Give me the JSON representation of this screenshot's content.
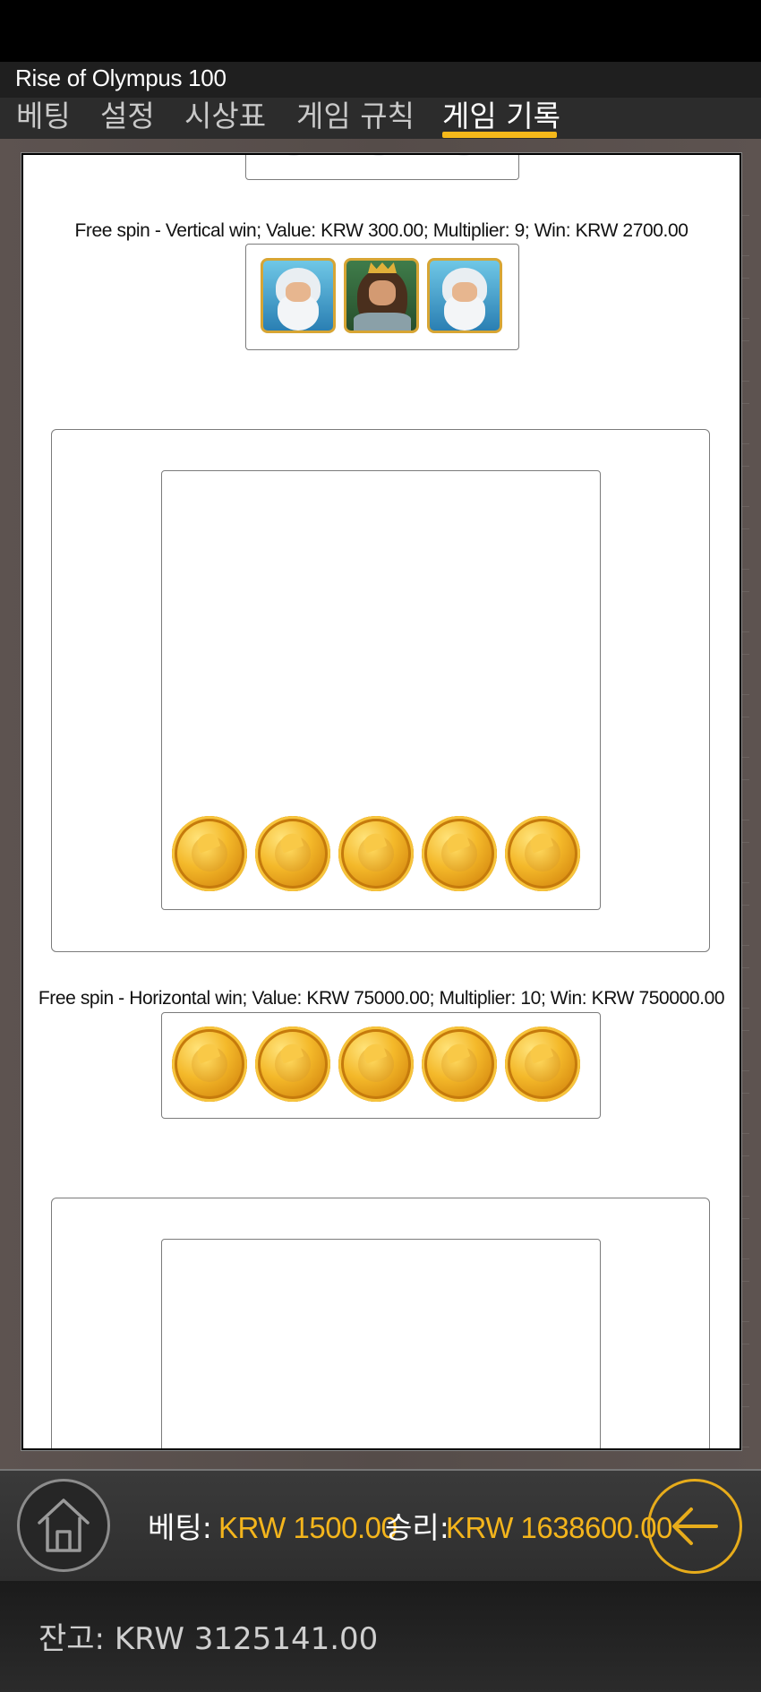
{
  "app": {
    "title": "Rise of Olympus 100"
  },
  "tabs": [
    {
      "label": "베팅",
      "active": false
    },
    {
      "label": "설정",
      "active": false
    },
    {
      "label": "시상표",
      "active": false
    },
    {
      "label": "게임 규칙",
      "active": false
    },
    {
      "label": "게임 기록",
      "active": true
    }
  ],
  "history": {
    "win1_caption": "Free spin - Vertical win; Value: KRW 300.00; Multiplier: 9; Win: KRW 2700.00",
    "win1_symbols": [
      "zeus-symbol",
      "hero-symbol",
      "zeus-symbol"
    ],
    "win2_caption": "Free spin - Horizontal win; Value: KRW 75000.00; Multiplier: 10; Win: KRW 750000.00",
    "win2_symbols": [
      "gold-coin-symbol",
      "gold-coin-symbol",
      "gold-coin-symbol",
      "gold-coin-symbol",
      "gold-coin-symbol"
    ]
  },
  "footer": {
    "bet_label": "베팅:",
    "bet_value": "KRW 1500.00",
    "win_label": "승리:",
    "win_value": "KRW 1638600.00",
    "balance_label": "잔고: KRW 3125141.00"
  },
  "colors": {
    "accent": "#f4b51c",
    "tab_bg": "#2c2c2c",
    "background": "#5a504d"
  },
  "icons": {
    "home": "home-icon",
    "back": "arrow-left-icon"
  }
}
